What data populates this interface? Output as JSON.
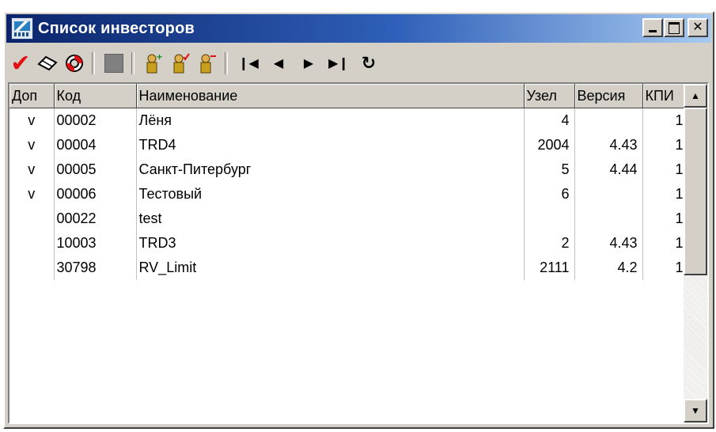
{
  "window": {
    "title": "Список инвесторов",
    "controls": [
      "minimize",
      "maximize",
      "close"
    ]
  },
  "toolbar": {
    "buttons": [
      {
        "icon": "check-mark-icon",
        "color": "#e21010"
      },
      {
        "icon": "eraser-icon"
      },
      {
        "icon": "lifebuoy-icon"
      },
      {
        "icon": "stop-square-icon",
        "disabled": true
      },
      {
        "icon": "user-add-icon"
      },
      {
        "icon": "user-check-icon"
      },
      {
        "icon": "user-remove-icon"
      },
      {
        "icon": "first-record-icon"
      },
      {
        "icon": "prev-record-icon"
      },
      {
        "icon": "next-record-icon"
      },
      {
        "icon": "last-record-icon"
      },
      {
        "icon": "refresh-icon"
      }
    ]
  },
  "grid": {
    "columns": [
      "Доп",
      "Код",
      "Наименование",
      "Узел",
      "Версия",
      "КПИ"
    ],
    "rows": [
      {
        "dop": "v",
        "code": "00002",
        "name": "Лёня",
        "node": "4",
        "version": "",
        "kpi": "1"
      },
      {
        "dop": "v",
        "code": "00004",
        "name": "TRD4",
        "node": "2004",
        "version": "4.43",
        "kpi": "1"
      },
      {
        "dop": "v",
        "code": "00005",
        "name": "Санкт-Питербург",
        "node": "5",
        "version": "4.44",
        "kpi": "1"
      },
      {
        "dop": "v",
        "code": "00006",
        "name": "Тестовый",
        "node": "6",
        "version": "",
        "kpi": "1"
      },
      {
        "dop": "",
        "code": "00022",
        "name": "test",
        "node": "",
        "version": "",
        "kpi": "1"
      },
      {
        "dop": "",
        "code": "10003",
        "name": "TRD3",
        "node": "2",
        "version": "4.43",
        "kpi": "1"
      },
      {
        "dop": "",
        "code": "30798",
        "name": "RV_Limit",
        "node": "2111",
        "version": "4.2",
        "kpi": "1"
      }
    ]
  }
}
